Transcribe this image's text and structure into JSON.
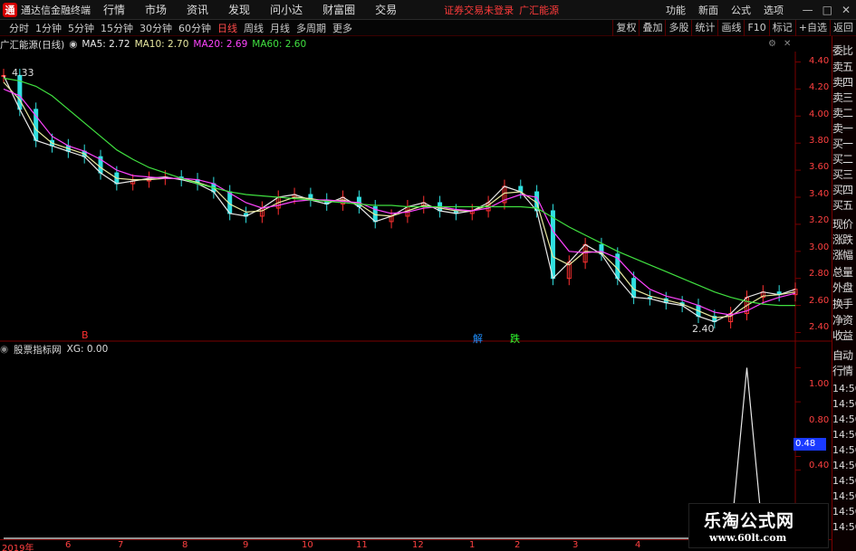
{
  "menubar": {
    "app_title": "通达信金融终端",
    "menus": [
      "行情",
      "市场",
      "资讯",
      "发现",
      "问小达",
      "财富圈",
      "交易"
    ],
    "login_status": "证券交易未登录",
    "stock_title": "广汇能源",
    "right_menus": [
      "功能",
      "新面",
      "公式",
      "选项"
    ],
    "win_controls": [
      "—",
      "□",
      "✕"
    ],
    "logo_glyph": "通"
  },
  "toolbar": {
    "periods": [
      "分时",
      "1分钟",
      "5分钟",
      "15分钟",
      "30分钟",
      "60分钟",
      "日线",
      "周线",
      "月线",
      "多周期",
      "更多"
    ],
    "active_period": "日线",
    "buttons": [
      "复权",
      "叠加",
      "多股",
      "统计",
      "画线",
      "F10",
      "标记",
      "+自选",
      "返回"
    ]
  },
  "legend": {
    "name": "广汇能源(日线)",
    "ma5": "MA5: 2.72",
    "ma10": "MA10: 2.70",
    "ma20": "MA20: 2.69",
    "ma60": "MA60: 2.60",
    "colors": {
      "ma5": "#e8e8e8",
      "ma10": "#e8e8a0",
      "ma20": "#ff44ff",
      "ma60": "#40e040"
    }
  },
  "price_axis": [
    "4.40",
    "4.20",
    "4.00",
    "3.80",
    "3.60",
    "3.40",
    "3.20",
    "3.00",
    "2.80",
    "2.60",
    "2.40"
  ],
  "annotations": {
    "high": "4.33",
    "low": "2.40"
  },
  "markers": [
    {
      "text": "B",
      "color": "#ff3030"
    },
    {
      "text": "解",
      "color": "#2090ff"
    },
    {
      "text": "跌",
      "color": "#30ff30"
    }
  ],
  "sub_indicator": {
    "name": "股票指标网",
    "value": "XG: 0.00",
    "axis": [
      "1.00",
      "0.80",
      "0.48",
      "0.40"
    ],
    "current": "0.48"
  },
  "x_axis": [
    "2019年",
    "6",
    "7",
    "8",
    "9",
    "10",
    "11",
    "12",
    "1",
    "2",
    "3",
    "4"
  ],
  "side_panel": {
    "items": [
      "委比",
      "卖五",
      "卖四",
      "卖三",
      "卖二",
      "卖一",
      "买一",
      "买二",
      "买三",
      "买四",
      "买五",
      "现价",
      "涨跌",
      "涨幅",
      "总量",
      "外盘",
      "换手",
      "净资",
      "收益"
    ],
    "bottom_items": [
      "自动",
      "行情"
    ],
    "times": [
      "14:50",
      "14:50",
      "14:50",
      "14:50",
      "14:50",
      "14:50",
      "14:50",
      "14:50",
      "14:50",
      "14:50"
    ]
  },
  "watermark": {
    "title": "乐淘公式网",
    "url": "www.60lt.com"
  },
  "chart_data": {
    "type": "line",
    "title": "广汇能源(日线)",
    "ylim": [
      2.35,
      4.45
    ],
    "series": [
      {
        "name": "MA5",
        "color": "#e8e8e8",
        "values": [
          4.3,
          4.05,
          3.82,
          3.78,
          3.74,
          3.7,
          3.58,
          3.5,
          3.52,
          3.54,
          3.55,
          3.53,
          3.5,
          3.44,
          3.28,
          3.26,
          3.32,
          3.4,
          3.42,
          3.38,
          3.35,
          3.4,
          3.33,
          3.22,
          3.26,
          3.33,
          3.36,
          3.3,
          3.28,
          3.3,
          3.36,
          3.48,
          3.44,
          3.3,
          2.8,
          2.92,
          3.05,
          2.98,
          2.8,
          2.66,
          2.65,
          2.62,
          2.6,
          2.52,
          2.48,
          2.54,
          2.66,
          2.7,
          2.68,
          2.72
        ]
      },
      {
        "name": "MA10",
        "color": "#e8e8a0",
        "values": [
          4.25,
          4.12,
          3.9,
          3.8,
          3.76,
          3.72,
          3.62,
          3.54,
          3.53,
          3.53,
          3.54,
          3.54,
          3.51,
          3.47,
          3.35,
          3.29,
          3.3,
          3.36,
          3.4,
          3.39,
          3.37,
          3.38,
          3.35,
          3.27,
          3.26,
          3.3,
          3.34,
          3.32,
          3.3,
          3.3,
          3.34,
          3.43,
          3.44,
          3.36,
          2.96,
          2.9,
          3.0,
          2.99,
          2.87,
          2.72,
          2.67,
          2.64,
          2.61,
          2.56,
          2.51,
          2.52,
          2.6,
          2.67,
          2.68,
          2.7
        ]
      },
      {
        "name": "MA20",
        "color": "#ff44ff",
        "values": [
          4.2,
          4.15,
          4.0,
          3.85,
          3.78,
          3.74,
          3.68,
          3.6,
          3.56,
          3.55,
          3.54,
          3.54,
          3.53,
          3.5,
          3.43,
          3.36,
          3.32,
          3.34,
          3.37,
          3.38,
          3.38,
          3.37,
          3.36,
          3.31,
          3.28,
          3.29,
          3.32,
          3.33,
          3.31,
          3.3,
          3.32,
          3.38,
          3.42,
          3.4,
          3.15,
          3.0,
          2.99,
          3.0,
          2.95,
          2.82,
          2.72,
          2.67,
          2.64,
          2.6,
          2.55,
          2.53,
          2.56,
          2.62,
          2.66,
          2.69
        ]
      },
      {
        "name": "MA60",
        "color": "#40e040",
        "values": [
          4.28,
          4.26,
          4.22,
          4.15,
          4.05,
          3.95,
          3.85,
          3.75,
          3.68,
          3.62,
          3.58,
          3.54,
          3.5,
          3.47,
          3.44,
          3.42,
          3.41,
          3.4,
          3.39,
          3.38,
          3.37,
          3.36,
          3.35,
          3.34,
          3.34,
          3.33,
          3.33,
          3.33,
          3.33,
          3.33,
          3.33,
          3.33,
          3.33,
          3.32,
          3.25,
          3.18,
          3.12,
          3.06,
          3.0,
          2.95,
          2.9,
          2.85,
          2.8,
          2.75,
          2.7,
          2.66,
          2.63,
          2.61,
          2.6,
          2.6
        ]
      }
    ],
    "sub_series": {
      "name": "XG",
      "values": [
        0,
        0,
        0,
        0,
        0,
        0,
        0,
        0,
        0,
        0,
        0,
        0,
        0,
        0,
        0,
        0,
        0,
        0,
        0,
        0,
        0,
        0,
        0,
        0,
        0,
        0,
        0,
        0,
        0,
        0,
        0,
        0,
        0,
        0,
        0,
        0,
        0,
        0,
        0,
        0,
        0,
        0,
        0,
        0,
        0,
        0,
        1.0,
        0,
        0,
        0
      ],
      "ylim": [
        0,
        1.05
      ]
    }
  }
}
